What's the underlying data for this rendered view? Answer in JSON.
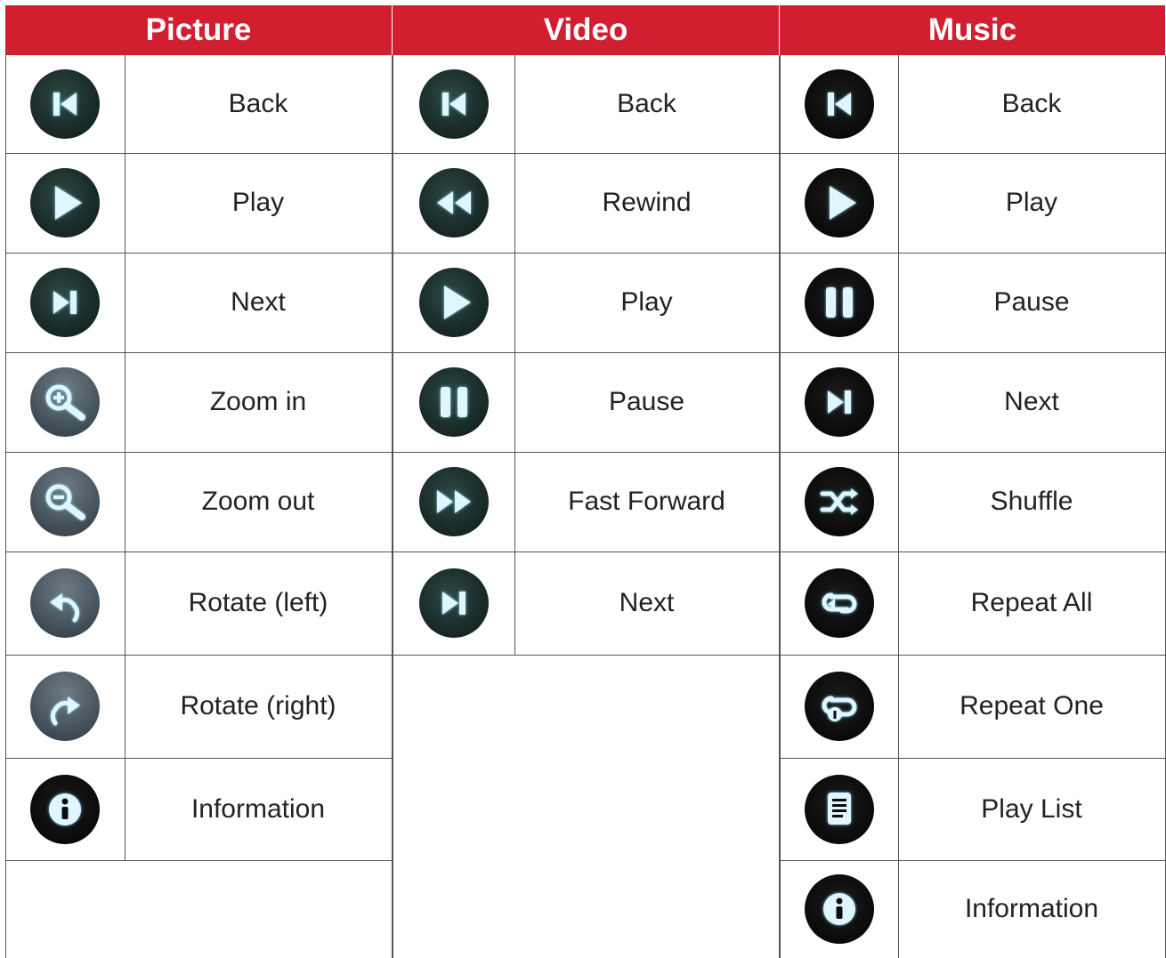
{
  "columns": [
    {
      "title": "Picture",
      "items": [
        {
          "icon": "back-icon",
          "label": "Back",
          "style": "dark-green"
        },
        {
          "icon": "play-icon",
          "label": "Play",
          "style": "dark-green"
        },
        {
          "icon": "next-icon",
          "label": "Next",
          "style": "dark-green"
        },
        {
          "icon": "zoom-in-icon",
          "label": "Zoom in",
          "style": "gray"
        },
        {
          "icon": "zoom-out-icon",
          "label": "Zoom out",
          "style": "gray"
        },
        {
          "icon": "rotate-left-icon",
          "label": "Rotate (left)",
          "style": "gray"
        },
        {
          "icon": "rotate-right-icon",
          "label": "Rotate (right)",
          "style": "gray"
        },
        {
          "icon": "info-icon",
          "label": "Information",
          "style": "black"
        }
      ]
    },
    {
      "title": "Video",
      "items": [
        {
          "icon": "back-icon",
          "label": "Back",
          "style": "dark-green"
        },
        {
          "icon": "rewind-icon",
          "label": "Rewind",
          "style": "dark-green"
        },
        {
          "icon": "play-icon",
          "label": "Play",
          "style": "dark-green"
        },
        {
          "icon": "pause-icon",
          "label": "Pause",
          "style": "dark-green"
        },
        {
          "icon": "fast-forward-icon",
          "label": "Fast Forward",
          "style": "dark-green"
        },
        {
          "icon": "next-icon",
          "label": "Next",
          "style": "dark-green"
        }
      ]
    },
    {
      "title": "Music",
      "items": [
        {
          "icon": "back-icon",
          "label": "Back",
          "style": "black"
        },
        {
          "icon": "play-icon",
          "label": "Play",
          "style": "black"
        },
        {
          "icon": "pause-icon",
          "label": "Pause",
          "style": "black"
        },
        {
          "icon": "next-icon",
          "label": "Next",
          "style": "black"
        },
        {
          "icon": "shuffle-icon",
          "label": "Shuffle",
          "style": "black"
        },
        {
          "icon": "repeat-all-icon",
          "label": "Repeat All",
          "style": "black"
        },
        {
          "icon": "repeat-one-icon",
          "label": "Repeat One",
          "style": "black"
        },
        {
          "icon": "playlist-icon",
          "label": "Play List",
          "style": "black"
        },
        {
          "icon": "info-icon",
          "label": "Information",
          "style": "black"
        }
      ]
    }
  ],
  "colors": {
    "header_bg": "#d21f2f",
    "header_text": "#ffffff",
    "icon_glyph": "#dff6ff",
    "icon_glow": "#7fd8ff"
  }
}
